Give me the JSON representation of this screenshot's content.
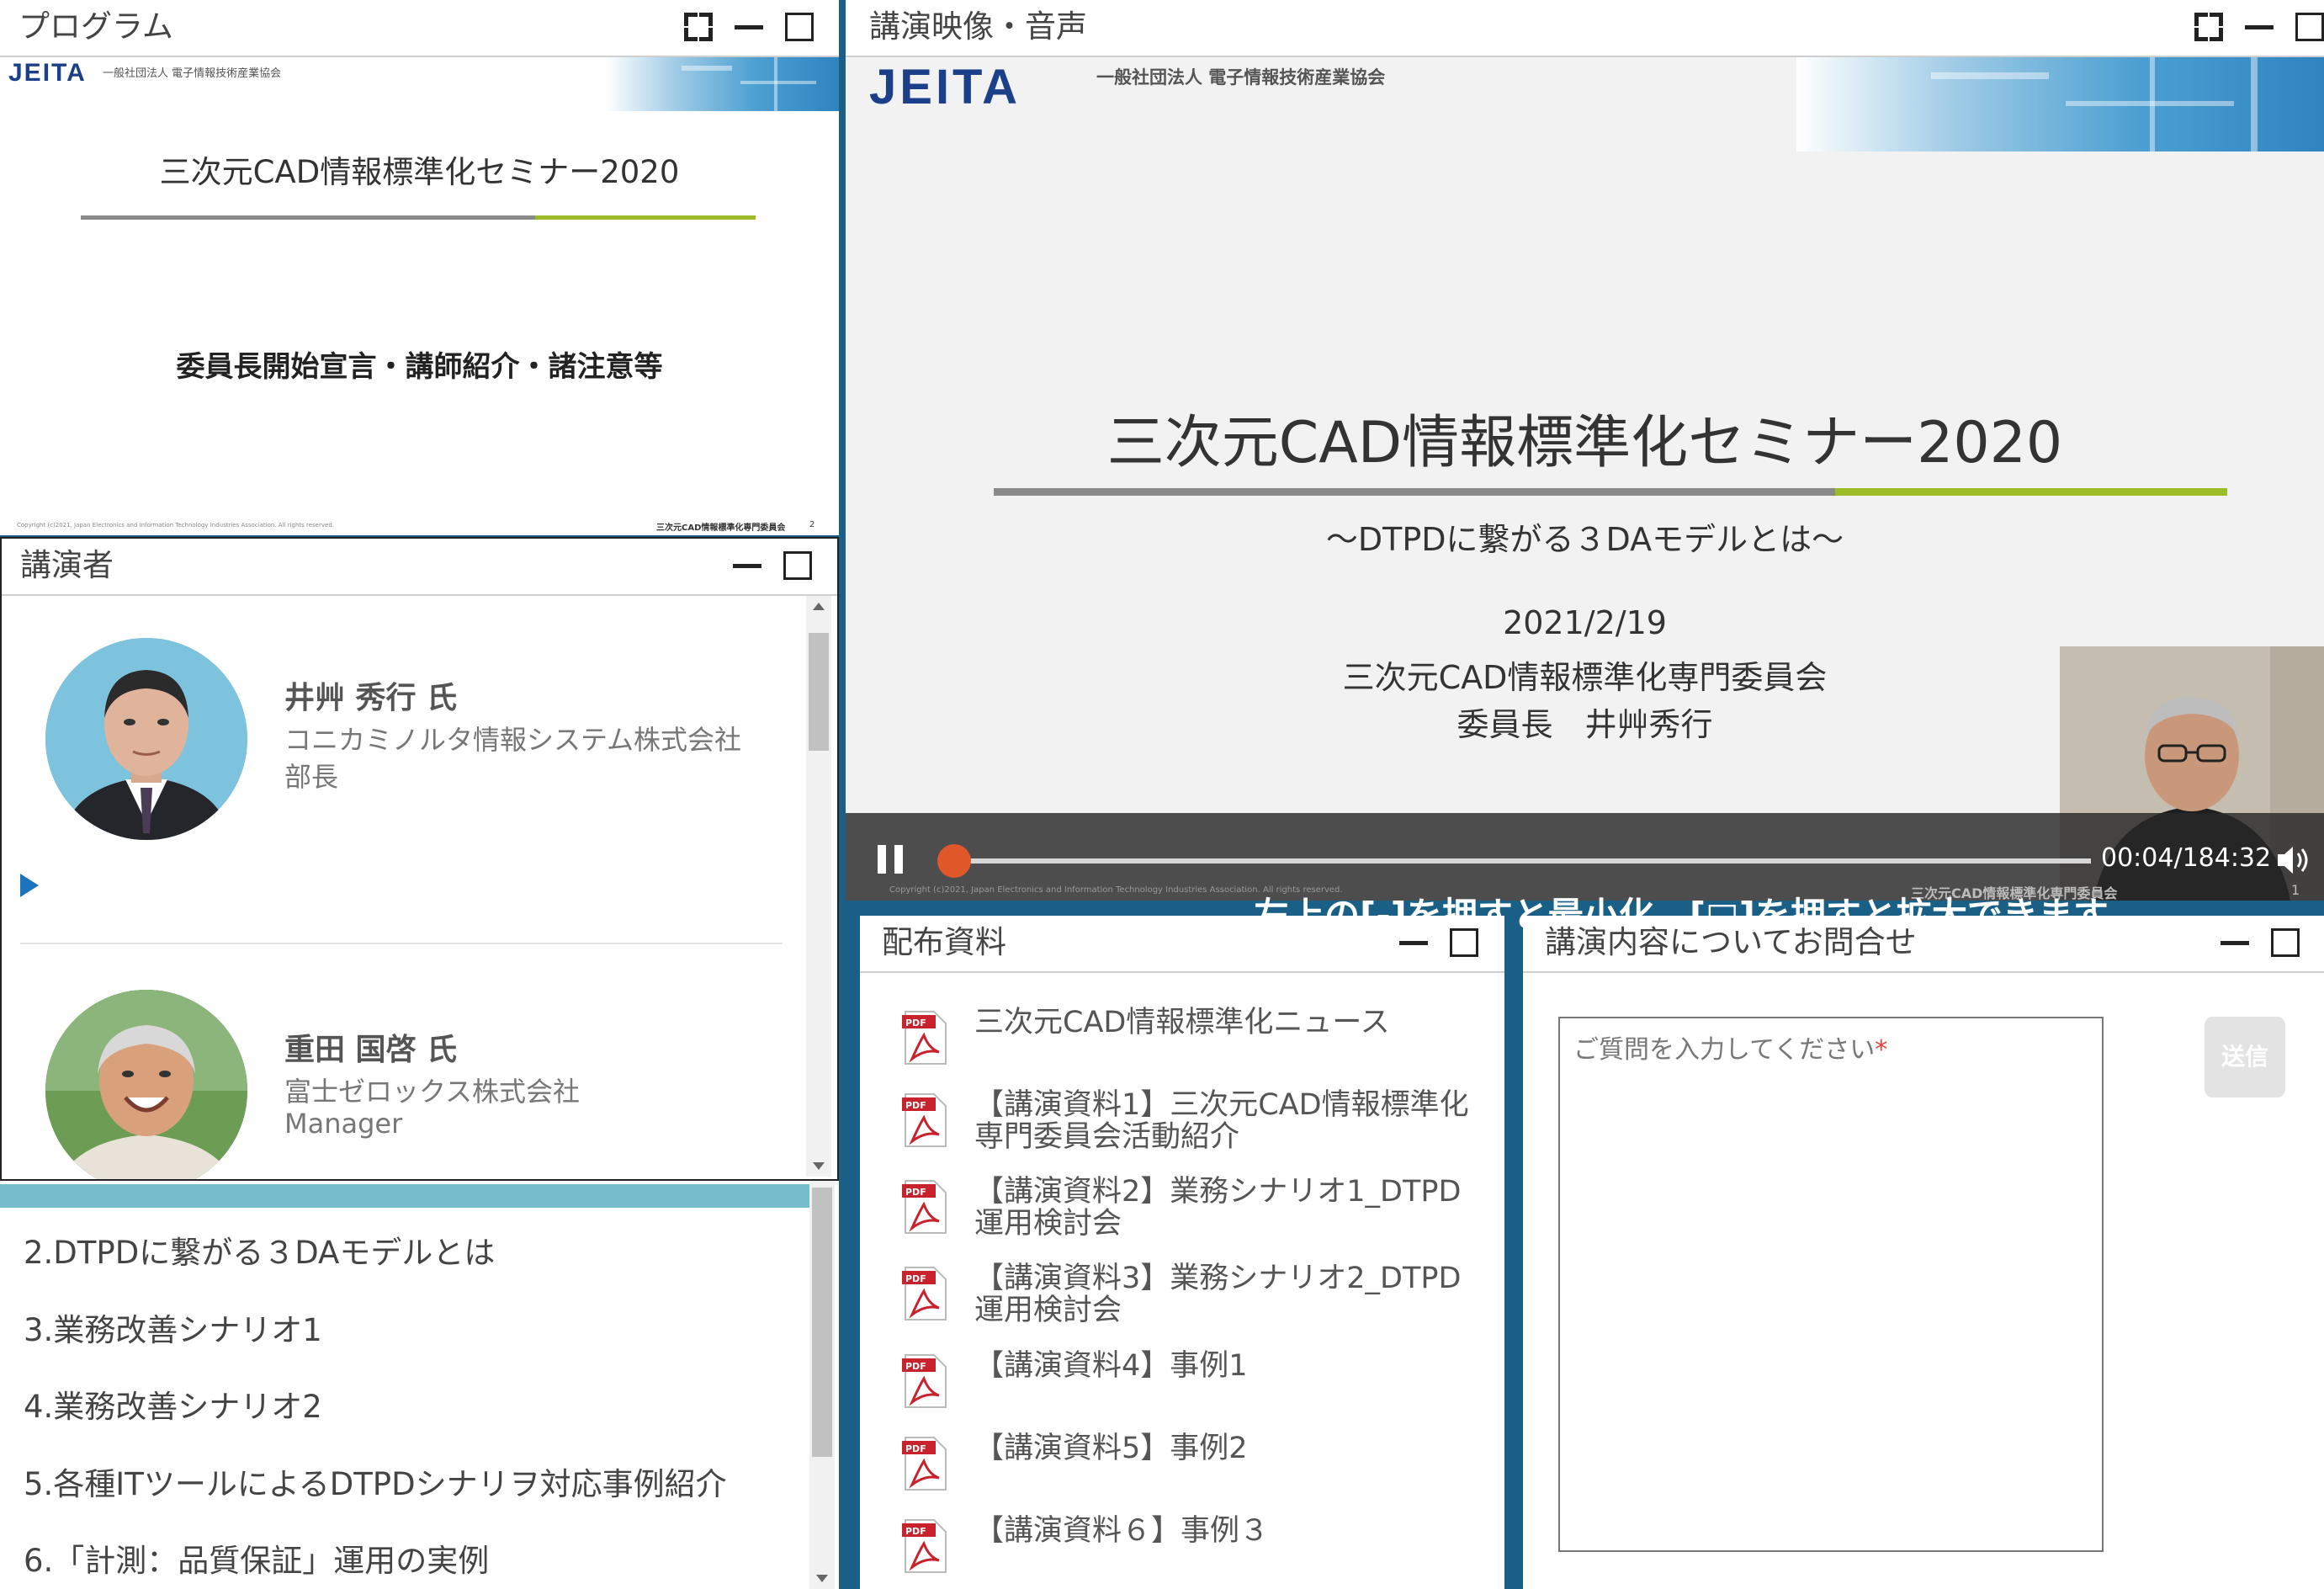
{
  "colors": {
    "accent_blue": "#1a5f86",
    "lime": "#9cbd27",
    "jeita_blue": "#1c3f8a",
    "progress": "#e0572a",
    "required": "#e0403c"
  },
  "program_panel": {
    "title": "プログラム",
    "slide": {
      "logo": "JEITA",
      "org": "一般社団法人 電子情報技術産業協会",
      "heading": "三次元CAD情報標準化セミナー2020",
      "subject": "委員長開始宣言・講師紹介・諸注意等",
      "copyright": "Copyright (c)2021, Japan Electronics and Information Technology Industries Association. All rights reserved.",
      "footer": "三次元CAD情報標準化専門委員会",
      "page": "2"
    }
  },
  "video_panel": {
    "title": "講演映像・音声",
    "slide": {
      "logo": "JEITA",
      "org": "一般社団法人 電子情報技術産業協会",
      "heading": "三次元CAD情報標準化セミナー2020",
      "subtitle": "～DTPDに繋がる３DAモデルとは～",
      "date": "2021/2/19",
      "committee": "三次元CAD情報標準化専門委員会",
      "chair": "委員長　井艸秀行",
      "copyright": "Copyright (c)2021, Japan Electronics and Information Technology Industries Association. All rights reserved.",
      "footer": "三次元CAD情報標準化専門委員会",
      "page": "1"
    },
    "player": {
      "time": "00:04/184:32",
      "progress": 0.0004,
      "caption": "左上の[-]を押すと最小化、[□]を押すと拡大できます"
    }
  },
  "speakers_panel": {
    "title": "講演者",
    "speakers": [
      {
        "name": "井艸 秀行 氏",
        "company": "コニカミノルタ情報システム株式会社",
        "position": "部長"
      },
      {
        "name": "重田 国啓 氏",
        "company": "富士ゼロックス株式会社",
        "position": "Manager"
      }
    ]
  },
  "agenda": {
    "items": [
      "2.DTPDに繋がる３DAモデルとは",
      "3.業務改善シナリオ1",
      "4.業務改善シナリオ2",
      "5.各種ITツールによるDTPDシナリヲ対応事例紹介",
      "6.「計測：品質保証」運用の実例"
    ]
  },
  "documents_panel": {
    "title": "配布資料",
    "items": [
      "三次元CAD情報標準化ニュース",
      "【講演資料1】三次元CAD情報標準化専門委員会活動紹介",
      "【講演資料2】業務シナリオ1_DTPD運用検討会",
      "【講演資料3】業務シナリオ2_DTPD運用検討会",
      "【講演資料4】事例1",
      "【講演資料5】事例2",
      "【講演資料６】事例３"
    ],
    "icon": "pdf-icon",
    "icon_label": "PDF"
  },
  "inquiry_panel": {
    "title": "講演内容についてお問合せ",
    "placeholder": "ご質問を入力してください",
    "required_mark": "*",
    "send_label": "送信"
  }
}
